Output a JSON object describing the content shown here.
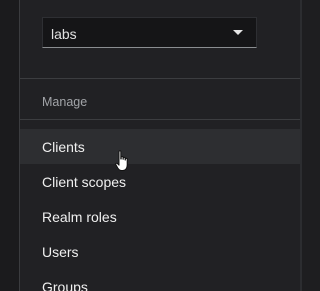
{
  "realm_selector": {
    "value": "labs"
  },
  "sidebar": {
    "section_title": "Manage",
    "items": [
      {
        "label": "Clients"
      },
      {
        "label": "Client scopes"
      },
      {
        "label": "Realm roles"
      },
      {
        "label": "Users"
      },
      {
        "label": "Groups"
      }
    ]
  },
  "colors": {
    "background": "#1e1e20",
    "sidebar": "#212124",
    "hover": "#2d2e31",
    "text": "#f0f0f0",
    "muted_text": "#a2a4a8"
  },
  "icons": {
    "dropdown": "caret-down-icon",
    "pointer": "hand-pointer-icon"
  }
}
